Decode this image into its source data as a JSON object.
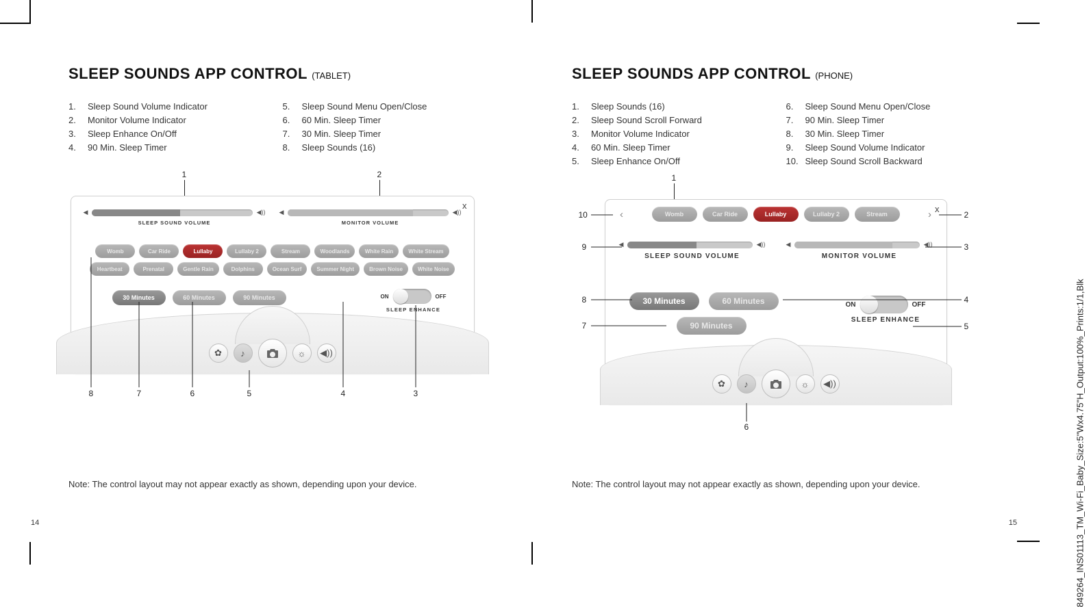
{
  "sideLabel": "849264_INS01113_TM_Wi-Fi_Baby_Size:5\"Wx4.75\"H_Output:100%_Prints:1/1,Blk",
  "left": {
    "title": "SLEEP SOUNDS APP CONTROL",
    "subtitle": "(TABLET)",
    "legendA": [
      {
        "n": "1.",
        "t": "Sleep Sound Volume Indicator"
      },
      {
        "n": "2.",
        "t": "Monitor Volume Indicator"
      },
      {
        "n": "3.",
        "t": "Sleep Enhance On/Off"
      },
      {
        "n": "4.",
        "t": "90 Min. Sleep Timer"
      }
    ],
    "legendB": [
      {
        "n": "5.",
        "t": "Sleep Sound Menu Open/Close"
      },
      {
        "n": "6.",
        "t": "60 Min. Sleep Timer"
      },
      {
        "n": "7.",
        "t": "30 Min. Sleep Timer"
      },
      {
        "n": "8.",
        "t": "Sleep Sounds (16)"
      }
    ],
    "sliders": {
      "a": "SLEEP SOUND VOLUME",
      "b": "MONITOR VOLUME"
    },
    "sounds": [
      "Womb",
      "Car Ride",
      "Lullaby",
      "Lullaby 2",
      "Stream",
      "Woodlands",
      "White Rain",
      "White Stream",
      "Heartbeat",
      "Prenatal",
      "Gentle Rain",
      "Dolphins",
      "Ocean Surf",
      "Summer Night",
      "Brown Noise",
      "White Noise"
    ],
    "selectedSoundIndex": 2,
    "timers": [
      "30 Minutes",
      "60 Minutes",
      "90 Minutes"
    ],
    "toggle": {
      "on": "ON",
      "off": "OFF",
      "caption": "SLEEP ENHANCE"
    },
    "callouts": {
      "top": [
        "1",
        "2"
      ],
      "bottom": [
        "8",
        "7",
        "6",
        "5",
        "4",
        "3"
      ]
    },
    "note": "Note: The control layout may not appear exactly as shown, depending upon your device.",
    "pagenum": "14"
  },
  "right": {
    "title": "SLEEP SOUNDS APP CONTROL",
    "subtitle": "(PHONE)",
    "legendA": [
      {
        "n": "1.",
        "t": "Sleep Sounds (16)"
      },
      {
        "n": "2.",
        "t": "Sleep Sound Scroll Forward"
      },
      {
        "n": "3.",
        "t": "Monitor Volume Indicator"
      },
      {
        "n": "4.",
        "t": "60 Min. Sleep Timer"
      },
      {
        "n": "5.",
        "t": "Sleep Enhance On/Off"
      }
    ],
    "legendB": [
      {
        "n": "6.",
        "t": "Sleep Sound Menu Open/Close"
      },
      {
        "n": "7.",
        "t": "90 Min. Sleep Timer"
      },
      {
        "n": "8.",
        "t": "30 Min. Sleep Timer"
      },
      {
        "n": "9.",
        "t": "Sleep Sound Volume Indicator"
      },
      {
        "n": "10.",
        "t": "Sleep Sound Scroll Backward"
      }
    ],
    "sliders": {
      "a": "SLEEP SOUND VOLUME",
      "b": "MONITOR VOLUME"
    },
    "sounds": [
      "Womb",
      "Car Ride",
      "Lullaby",
      "Lullaby 2",
      "Stream"
    ],
    "selectedSoundIndex": 2,
    "timers": [
      "30 Minutes",
      "60 Minutes",
      "90 Minutes"
    ],
    "toggle": {
      "on": "ON",
      "off": "OFF",
      "caption": "SLEEP ENHANCE"
    },
    "callouts": {
      "top": [
        "1"
      ],
      "leftSide": [
        "10",
        "9",
        "8",
        "7"
      ],
      "rightSide": [
        "2",
        "3",
        "4",
        "5"
      ],
      "bottom": [
        "6"
      ]
    },
    "note": "Note: The control layout may not appear exactly as shown, depending upon your device.",
    "pagenum": "15"
  }
}
